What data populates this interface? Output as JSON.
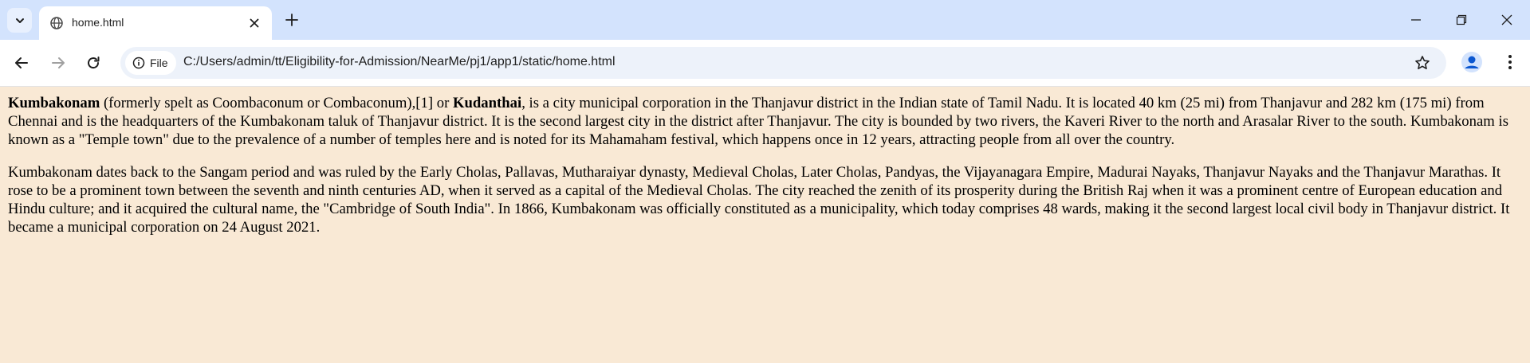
{
  "browser": {
    "tab": {
      "title": "home.html"
    },
    "omnibox": {
      "scheme_label": "File",
      "url": "C:/Users/admin/tt/Eligibility-for-Admission/NearMe/pj1/app1/static/home.html"
    },
    "icons": {
      "tab_search": "chevron-down-icon",
      "favicon": "globe-icon",
      "close": "close-icon",
      "new_tab": "plus-icon",
      "back": "back-arrow-icon",
      "forward": "forward-arrow-icon",
      "reload": "reload-icon",
      "info": "info-icon",
      "bookmark": "star-icon",
      "profile": "avatar-icon",
      "menu": "kebab-menu-icon"
    },
    "colors": {
      "tabbar": "#d3e3fd",
      "omnibox": "#edf2fa",
      "page_background": "#f9e9d5"
    }
  },
  "page": {
    "para1": {
      "name1": "Kumbakonam",
      "text1": " (formerly spelt as Coombaconum or Combaconum),[1] or ",
      "name2": "Kudanthai",
      "text2": ", is a city municipal corporation in the Thanjavur district in the Indian state of Tamil Nadu. It is located 40 km (25 mi) from Thanjavur and 282 km (175 mi) from Chennai and is the headquarters of the Kumbakonam taluk of Thanjavur district. It is the second largest city in the district after Thanjavur. The city is bounded by two rivers, the Kaveri River to the north and Arasalar River to the south. Kumbakonam is known as a \"Temple town\" due to the prevalence of a number of temples here and is noted for its Mahamaham festival, which happens once in 12 years, attracting people from all over the country."
    },
    "para2": "Kumbakonam dates back to the Sangam period and was ruled by the Early Cholas, Pallavas, Mutharaiyar dynasty, Medieval Cholas, Later Cholas, Pandyas, the Vijayanagara Empire, Madurai Nayaks, Thanjavur Nayaks and the Thanjavur Marathas. It rose to be a prominent town between the seventh and ninth centuries AD, when it served as a capital of the Medieval Cholas. The city reached the zenith of its prosperity during the British Raj when it was a prominent centre of European education and Hindu culture; and it acquired the cultural name, the \"Cambridge of South India\". In 1866, Kumbakonam was officially constituted as a municipality, which today comprises 48 wards, making it the second largest local civil body in Thanjavur district. It became a municipal corporation on 24 August 2021."
  }
}
